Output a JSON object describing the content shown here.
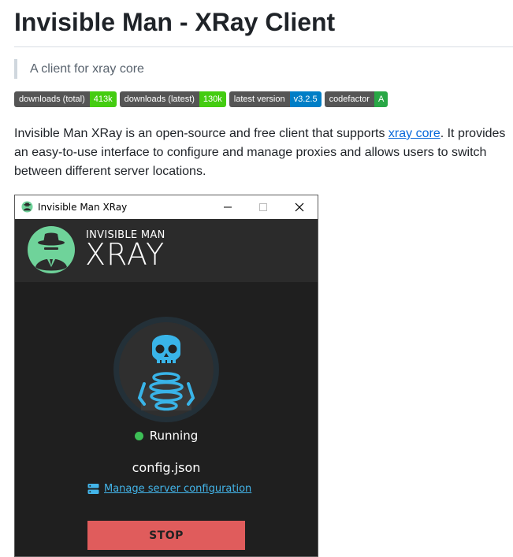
{
  "readme": {
    "title": "Invisible Man - XRay Client",
    "quote": "A client for xray core",
    "badges": [
      {
        "label": "downloads (total)",
        "value": "413k",
        "color": "#4c1"
      },
      {
        "label": "downloads (latest)",
        "value": "130k",
        "color": "#4c1"
      },
      {
        "label": "latest version",
        "value": "v3.2.5",
        "color": "#007ec6"
      },
      {
        "label": "codefactor",
        "value": "A",
        "color": "#28a745"
      }
    ],
    "intro_before": "Invisible Man XRay is an open-source and free client that supports ",
    "intro_link": "xray core",
    "intro_after": ". It provides an easy-to-use interface to configure and manage proxies and allows users to switch between different server locations."
  },
  "app": {
    "window_title": "Invisible Man XRay",
    "header_small": "INVISIBLE MAN",
    "header_big": "XRAY",
    "status": "Running",
    "status_color": "#3dbf56",
    "config_name": "config.json",
    "manage_link": "Manage server configuration",
    "stop_label": "STOP",
    "accent_color": "#43b5ea",
    "stop_color": "#e05c5c",
    "logo_color": "#6fd39a"
  }
}
